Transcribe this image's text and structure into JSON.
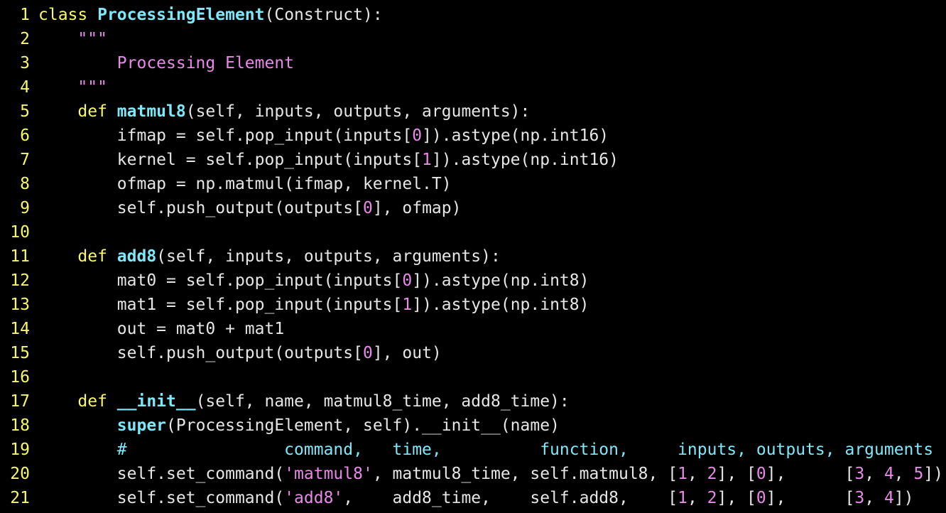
{
  "editor": {
    "colors": {
      "background": "#000000",
      "line_number": "#f7f76b",
      "plain": "#e6e6e6",
      "keyword": "#f7f76b",
      "function": "#7ee8f8",
      "number": "#e889e8",
      "string": "#e889e8",
      "comment": "#7ee8f8"
    },
    "lines": [
      {
        "n": "1",
        "tokens": [
          {
            "t": "class ",
            "c": "kw"
          },
          {
            "t": "ProcessingElement",
            "c": "fn"
          },
          {
            "t": "(Construct):",
            "c": "plain"
          }
        ]
      },
      {
        "n": "2",
        "tokens": [
          {
            "t": "    \"\"\"",
            "c": "doc"
          }
        ]
      },
      {
        "n": "3",
        "tokens": [
          {
            "t": "        Processing Element",
            "c": "doc"
          }
        ]
      },
      {
        "n": "4",
        "tokens": [
          {
            "t": "    \"\"\"",
            "c": "doc"
          }
        ]
      },
      {
        "n": "5",
        "tokens": [
          {
            "t": "    ",
            "c": "plain"
          },
          {
            "t": "def ",
            "c": "kw"
          },
          {
            "t": "matmul8",
            "c": "fn"
          },
          {
            "t": "(self, inputs, outputs, arguments):",
            "c": "plain"
          }
        ]
      },
      {
        "n": "6",
        "tokens": [
          {
            "t": "        ifmap = self.pop_input(inputs[",
            "c": "plain"
          },
          {
            "t": "0",
            "c": "num"
          },
          {
            "t": "]).astype(np.int16)",
            "c": "plain"
          }
        ]
      },
      {
        "n": "7",
        "tokens": [
          {
            "t": "        kernel = self.pop_input(inputs[",
            "c": "plain"
          },
          {
            "t": "1",
            "c": "num"
          },
          {
            "t": "]).astype(np.int16)",
            "c": "plain"
          }
        ]
      },
      {
        "n": "8",
        "tokens": [
          {
            "t": "        ofmap = np.matmul(ifmap, kernel.T)",
            "c": "plain"
          }
        ]
      },
      {
        "n": "9",
        "tokens": [
          {
            "t": "        self.push_output(outputs[",
            "c": "plain"
          },
          {
            "t": "0",
            "c": "num"
          },
          {
            "t": "], ofmap)",
            "c": "plain"
          }
        ]
      },
      {
        "n": "10",
        "tokens": []
      },
      {
        "n": "11",
        "tokens": [
          {
            "t": "    ",
            "c": "plain"
          },
          {
            "t": "def ",
            "c": "kw"
          },
          {
            "t": "add8",
            "c": "fn"
          },
          {
            "t": "(self, inputs, outputs, arguments):",
            "c": "plain"
          }
        ]
      },
      {
        "n": "12",
        "tokens": [
          {
            "t": "        mat0 = self.pop_input(inputs[",
            "c": "plain"
          },
          {
            "t": "0",
            "c": "num"
          },
          {
            "t": "]).astype(np.int8)",
            "c": "plain"
          }
        ]
      },
      {
        "n": "13",
        "tokens": [
          {
            "t": "        mat1 = self.pop_input(inputs[",
            "c": "plain"
          },
          {
            "t": "1",
            "c": "num"
          },
          {
            "t": "]).astype(np.int8)",
            "c": "plain"
          }
        ]
      },
      {
        "n": "14",
        "tokens": [
          {
            "t": "        out = mat0 + mat1",
            "c": "plain"
          }
        ]
      },
      {
        "n": "15",
        "tokens": [
          {
            "t": "        self.push_output(outputs[",
            "c": "plain"
          },
          {
            "t": "0",
            "c": "num"
          },
          {
            "t": "], out)",
            "c": "plain"
          }
        ]
      },
      {
        "n": "16",
        "tokens": []
      },
      {
        "n": "17",
        "tokens": [
          {
            "t": "    ",
            "c": "plain"
          },
          {
            "t": "def ",
            "c": "kw"
          },
          {
            "t": "__init__",
            "c": "fn"
          },
          {
            "t": "(self, name, matmul8_time, add8_time):",
            "c": "plain"
          }
        ]
      },
      {
        "n": "18",
        "tokens": [
          {
            "t": "        ",
            "c": "plain"
          },
          {
            "t": "super",
            "c": "builtin"
          },
          {
            "t": "(ProcessingElement, self).__init__(name)",
            "c": "plain"
          }
        ]
      },
      {
        "n": "19",
        "tokens": [
          {
            "t": "        #                command,   time,          function,     inputs, outputs, arguments",
            "c": "comment"
          }
        ]
      },
      {
        "n": "20",
        "tokens": [
          {
            "t": "        self.set_command(",
            "c": "plain"
          },
          {
            "t": "'matmul8'",
            "c": "str"
          },
          {
            "t": ", matmul8_time, self.matmul8, [",
            "c": "plain"
          },
          {
            "t": "1",
            "c": "num"
          },
          {
            "t": ", ",
            "c": "plain"
          },
          {
            "t": "2",
            "c": "num"
          },
          {
            "t": "], [",
            "c": "plain"
          },
          {
            "t": "0",
            "c": "num"
          },
          {
            "t": "],      [",
            "c": "plain"
          },
          {
            "t": "3",
            "c": "num"
          },
          {
            "t": ", ",
            "c": "plain"
          },
          {
            "t": "4",
            "c": "num"
          },
          {
            "t": ", ",
            "c": "plain"
          },
          {
            "t": "5",
            "c": "num"
          },
          {
            "t": "])",
            "c": "plain"
          }
        ]
      },
      {
        "n": "21",
        "tokens": [
          {
            "t": "        self.set_command(",
            "c": "plain"
          },
          {
            "t": "'add8'",
            "c": "str"
          },
          {
            "t": ",    add8_time,    self.add8,    [",
            "c": "plain"
          },
          {
            "t": "1",
            "c": "num"
          },
          {
            "t": ", ",
            "c": "plain"
          },
          {
            "t": "2",
            "c": "num"
          },
          {
            "t": "], [",
            "c": "plain"
          },
          {
            "t": "0",
            "c": "num"
          },
          {
            "t": "],      [",
            "c": "plain"
          },
          {
            "t": "3",
            "c": "num"
          },
          {
            "t": ", ",
            "c": "plain"
          },
          {
            "t": "4",
            "c": "num"
          },
          {
            "t": "])",
            "c": "plain"
          }
        ]
      }
    ]
  }
}
